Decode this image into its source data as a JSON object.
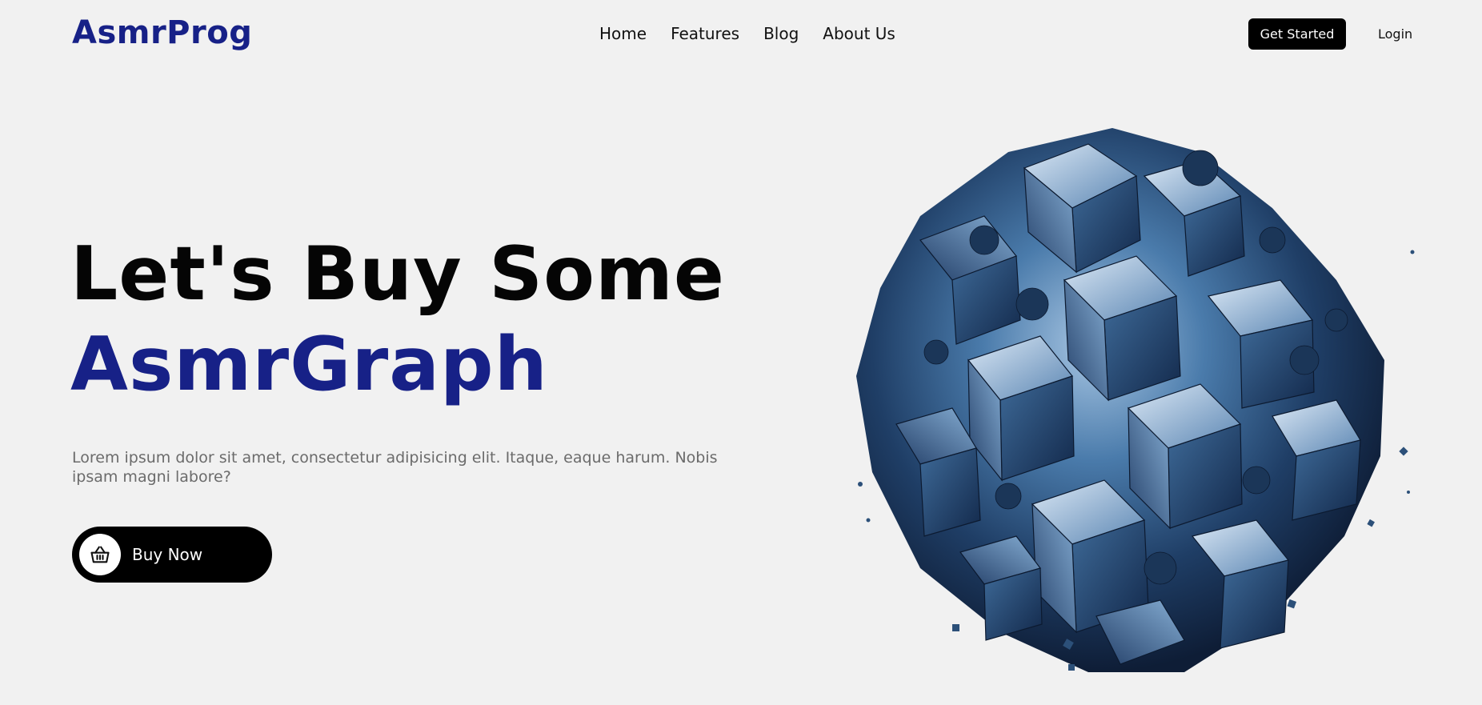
{
  "brand": {
    "name": "AsmrProg"
  },
  "nav": {
    "links": [
      {
        "label": "Home"
      },
      {
        "label": "Features"
      },
      {
        "label": "Blog"
      },
      {
        "label": "About Us"
      }
    ],
    "cta_label": "Get Started",
    "login_label": "Login"
  },
  "hero": {
    "title_line1": "Let's Buy Some",
    "title_line2": "AsmrGraph",
    "description": "Lorem ipsum dolor sit amet, consectetur adipisicing elit. Itaque, eaque harum. Nobis ipsam magni labore?",
    "button_label": "Buy Now",
    "button_icon": "basket-icon",
    "image_icon": "abstract-cube-sphere"
  },
  "colors": {
    "background": "#f1f1f1",
    "brand": "#172187",
    "text": "#050505",
    "muted": "#6b6b6b",
    "button": "#000000"
  }
}
